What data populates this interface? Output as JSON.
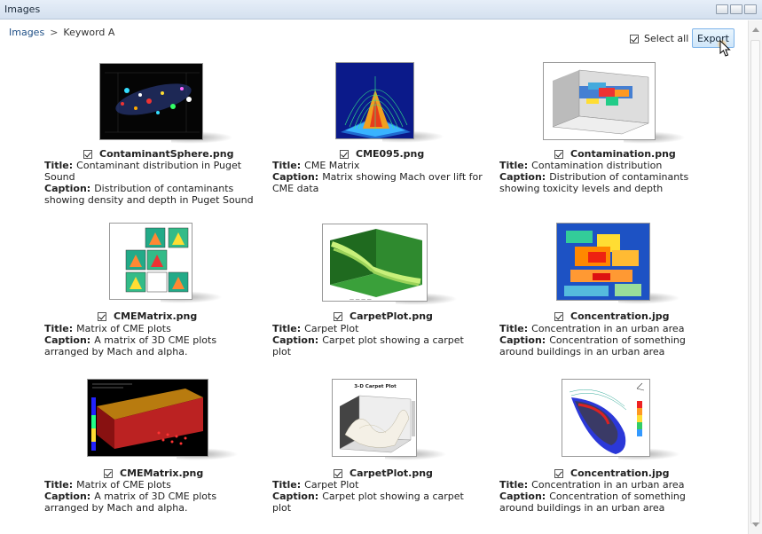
{
  "window": {
    "title": "Images"
  },
  "breadcrumb": {
    "root": "Images",
    "separator": ">",
    "current": "Keyword A"
  },
  "toolbar": {
    "select_all_label": "Select all",
    "export_label": "Export"
  },
  "labels": {
    "title": "Title:",
    "caption": "Caption:"
  },
  "items": [
    {
      "file": "ContaminantSphere.png",
      "title": "Contaminant distribution in Puget Sound",
      "caption": "Distribution of contaminants showing density and depth in Puget Sound",
      "checked": true
    },
    {
      "file": "CME095.png",
      "title": "CME Matrix",
      "caption": "Matrix showing Mach over lift for CME data",
      "checked": true
    },
    {
      "file": "Contamination.png",
      "title": "Contamination distribution",
      "caption": "Distribution of contaminants showing toxicity levels and depth",
      "checked": true
    },
    {
      "file": "CMEMatrix.png",
      "title": "Matrix of CME plots",
      "caption": "A matrix of 3D CME plots arranged by Mach and alpha.",
      "checked": true
    },
    {
      "file": "CarpetPlot.png",
      "title": "Carpet Plot",
      "caption": "Carpet plot showing a carpet plot",
      "checked": true
    },
    {
      "file": "Concentration.jpg",
      "title": "Concentration in an urban area",
      "caption": "Concentration of something around buildings in an urban area",
      "checked": true
    },
    {
      "file": "CMEMatrix.png",
      "title": "Matrix of CME plots",
      "caption": "A matrix of 3D CME plots arranged by Mach and alpha.",
      "checked": true
    },
    {
      "file": "CarpetPlot.png",
      "title": "Carpet Plot",
      "caption": "Carpet plot showing a carpet plot",
      "checked": true
    },
    {
      "file": "Concentration.jpg",
      "title": "Concentration in an urban area",
      "caption": "Concentration of something around buildings in an urban area",
      "checked": true
    }
  ],
  "thumb_text": {
    "carpet_title": "3-D Carpet Plot"
  }
}
